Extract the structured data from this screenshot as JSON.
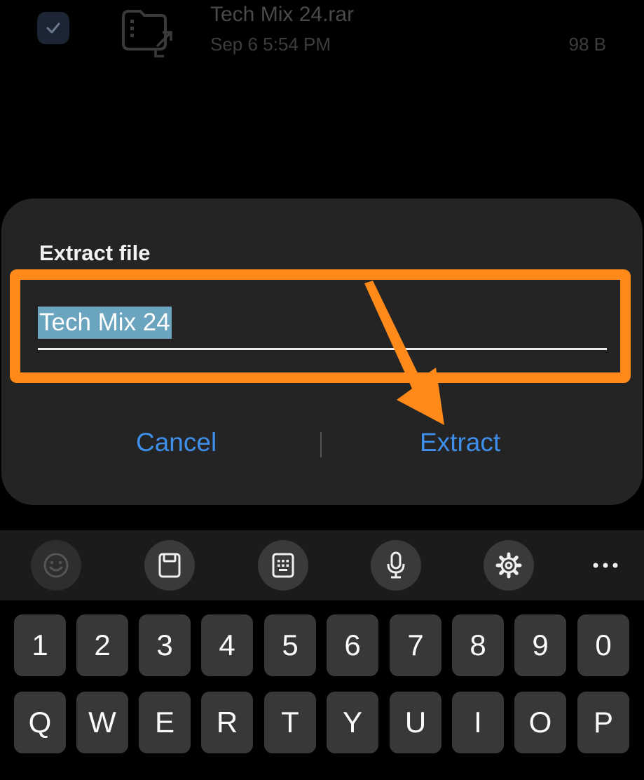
{
  "file_row": {
    "name": "Tech Mix 24.rar",
    "date": "Sep 6 5:54 PM",
    "size": "98 B"
  },
  "dialog": {
    "title": "Extract file",
    "input_value": "Tech Mix 24",
    "cancel_label": "Cancel",
    "extract_label": "Extract"
  },
  "toolbar": {
    "icons": [
      "emoji-icon",
      "clipboard-icon",
      "keyboard-mode-icon",
      "microphone-icon",
      "settings-gear-icon",
      "more-dots-icon"
    ]
  },
  "keyboard": {
    "number_row": [
      "1",
      "2",
      "3",
      "4",
      "5",
      "6",
      "7",
      "8",
      "9",
      "0"
    ],
    "letter_row": [
      "Q",
      "W",
      "E",
      "R",
      "T",
      "Y",
      "U",
      "I",
      "O",
      "P"
    ]
  },
  "colors": {
    "accent_button": "#3e8eea",
    "highlight_annotation": "#ff8a1a",
    "text_selection": "#6aa4bf",
    "dialog_bg": "#242424",
    "key_bg": "#383838"
  }
}
